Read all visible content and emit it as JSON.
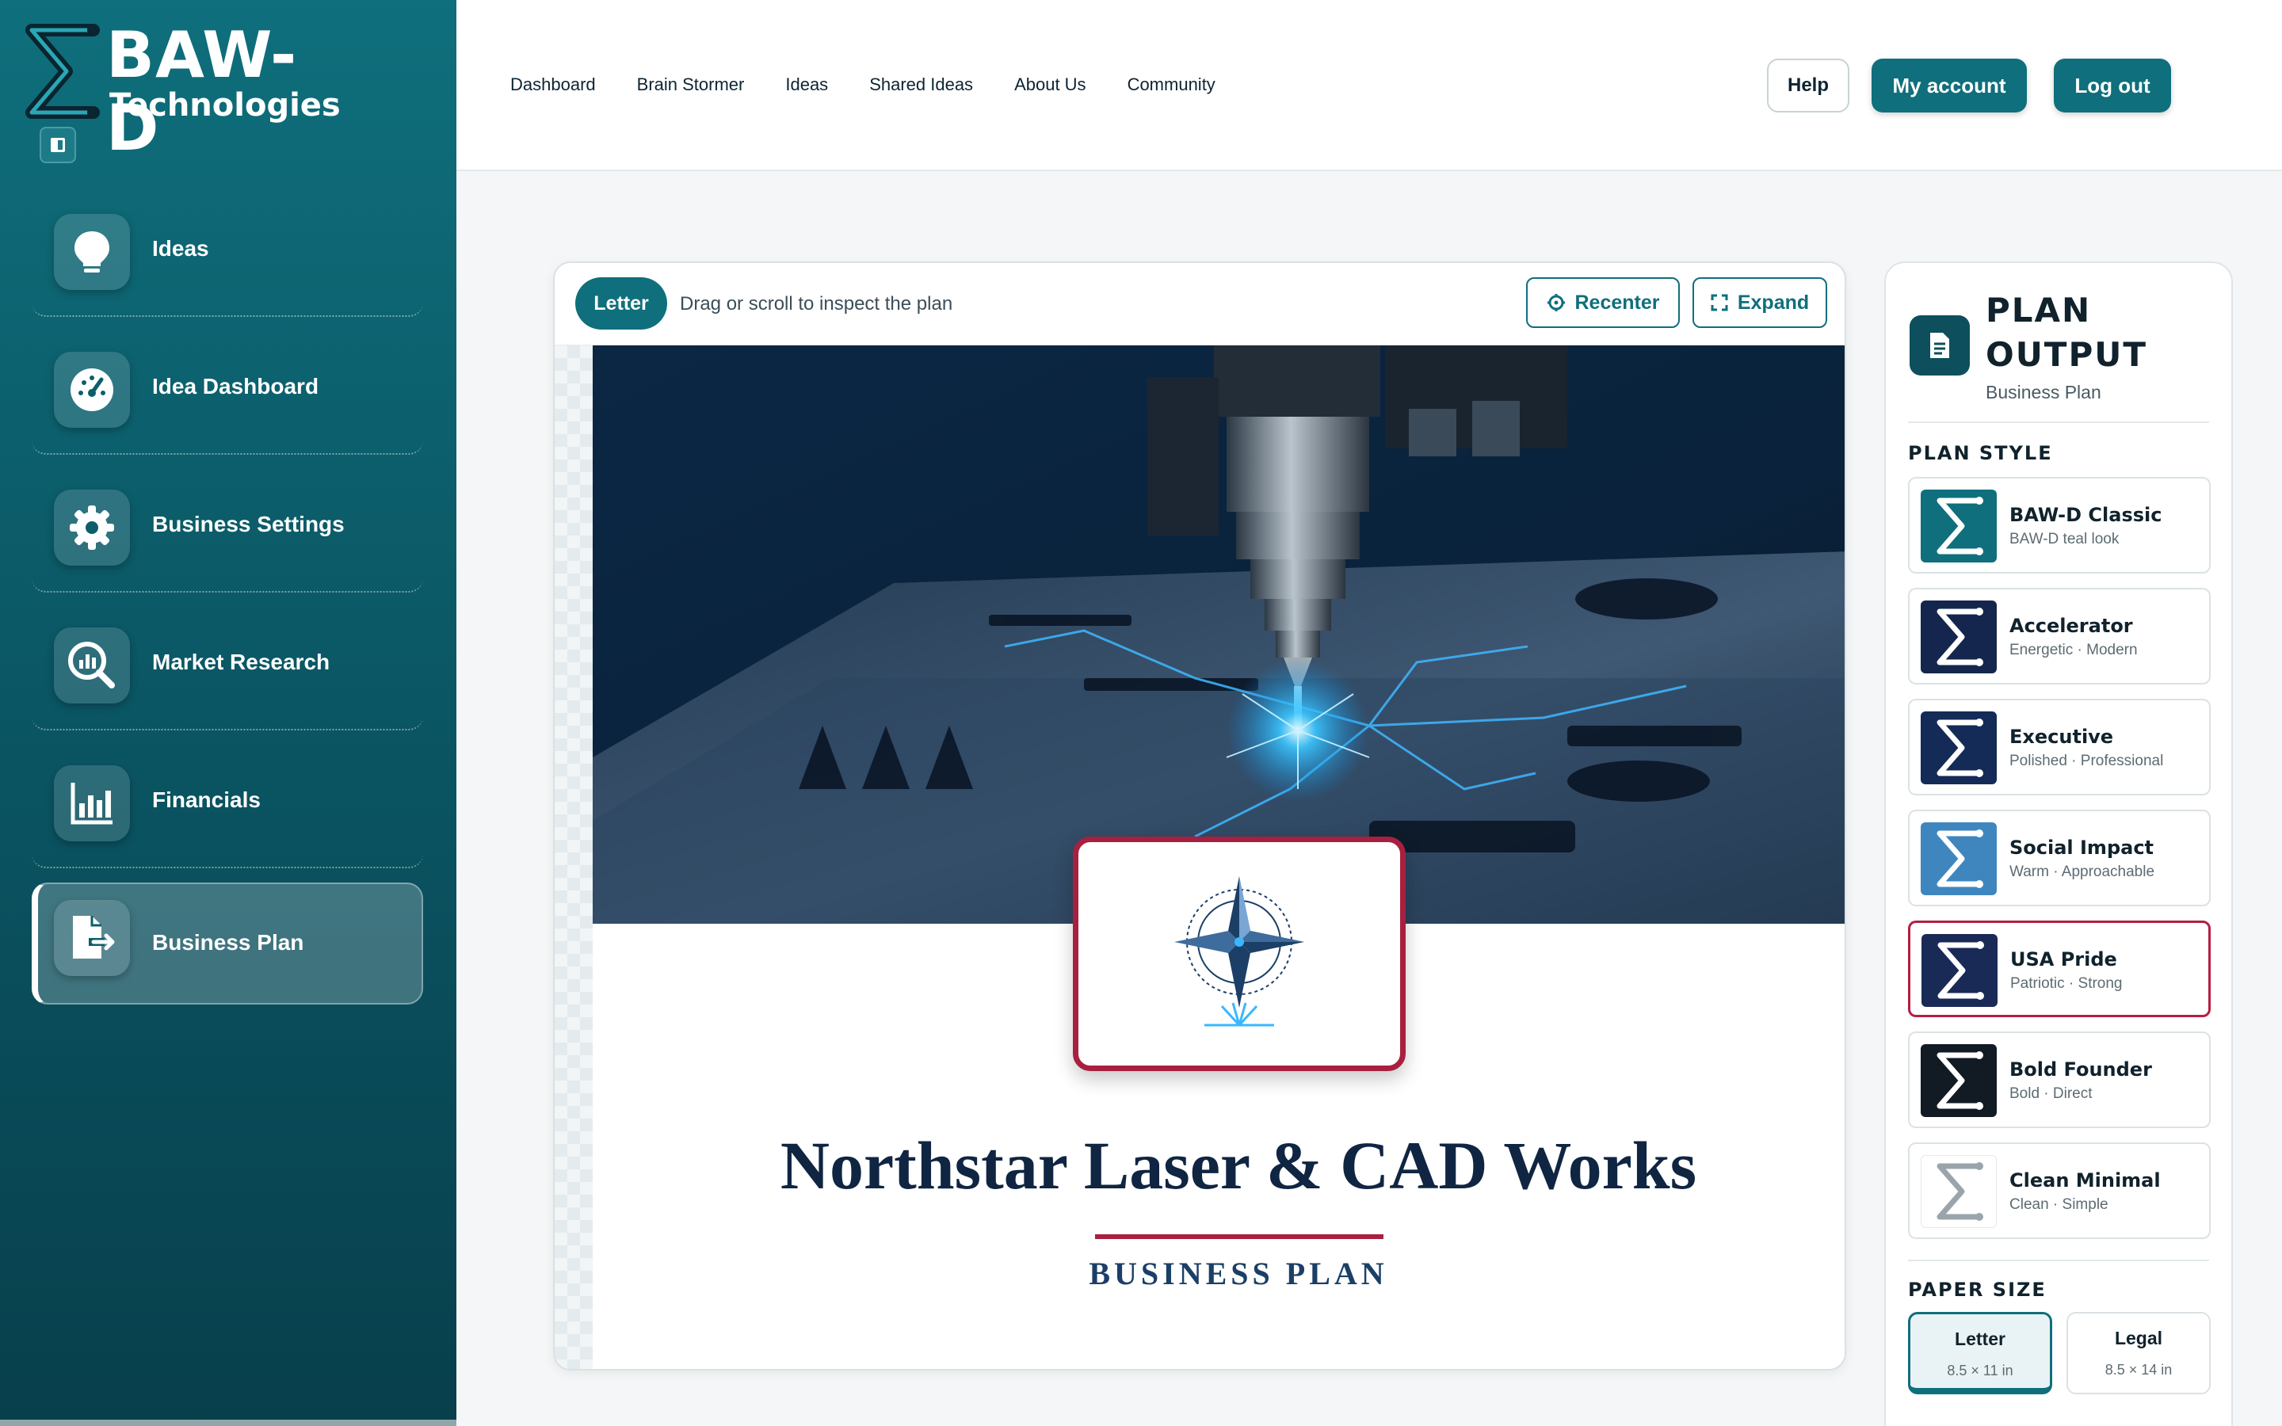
{
  "brand": {
    "name": "BAW-D",
    "sub": "Technologies"
  },
  "sidebar": {
    "items": [
      {
        "label": "Ideas",
        "icon": "lightbulb-icon"
      },
      {
        "label": "Idea Dashboard",
        "icon": "gauge-icon"
      },
      {
        "label": "Business Settings",
        "icon": "gear-icon"
      },
      {
        "label": "Market Research",
        "icon": "magnifier-chart-icon"
      },
      {
        "label": "Financials",
        "icon": "bar-chart-icon"
      },
      {
        "label": "Business Plan",
        "icon": "document-export-icon",
        "active": true
      }
    ]
  },
  "topnav": [
    "Dashboard",
    "Brain Stormer",
    "Ideas",
    "Shared Ideas",
    "About Us",
    "Community"
  ],
  "header": {
    "help": "Help",
    "account": "My account",
    "logout": "Log out"
  },
  "preview": {
    "paper_pill": "Letter",
    "hint": "Drag or scroll to inspect the plan",
    "recenter": "Recenter",
    "expand": "Expand",
    "plan_title": "Northstar Laser & CAD Works",
    "plan_subtitle": "BUSINESS PLAN"
  },
  "panel": {
    "title_line1": "PLAN",
    "title_line2": "OUTPUT",
    "subtitle": "Business Plan",
    "style_heading": "PLAN STYLE",
    "styles": [
      {
        "name": "BAW-D Classic",
        "desc": "BAW-D teal look",
        "color": "#0f6f7c"
      },
      {
        "name": "Accelerator",
        "desc": "Energetic · Modern",
        "color": "#14264d"
      },
      {
        "name": "Executive",
        "desc": "Polished · Professional",
        "color": "#142a57"
      },
      {
        "name": "Social Impact",
        "desc": "Warm · Approachable",
        "color": "#3f86bf"
      },
      {
        "name": "USA Pride",
        "desc": "Patriotic · Strong",
        "color": "#1a2a57",
        "selected": true
      },
      {
        "name": "Bold Founder",
        "desc": "Bold · Direct",
        "color": "#121a24"
      },
      {
        "name": "Clean Minimal",
        "desc": "Clean · Simple",
        "color": "#ffffff"
      }
    ],
    "paper_heading": "PAPER SIZE",
    "paper": [
      {
        "name": "Letter",
        "dims": "8.5 × 11 in",
        "selected": true
      },
      {
        "name": "Legal",
        "dims": "8.5 × 14 in"
      }
    ]
  },
  "colors": {
    "brand_teal": "#0f6f7c",
    "accent_red": "#a8203f",
    "navy": "#0f2542"
  }
}
